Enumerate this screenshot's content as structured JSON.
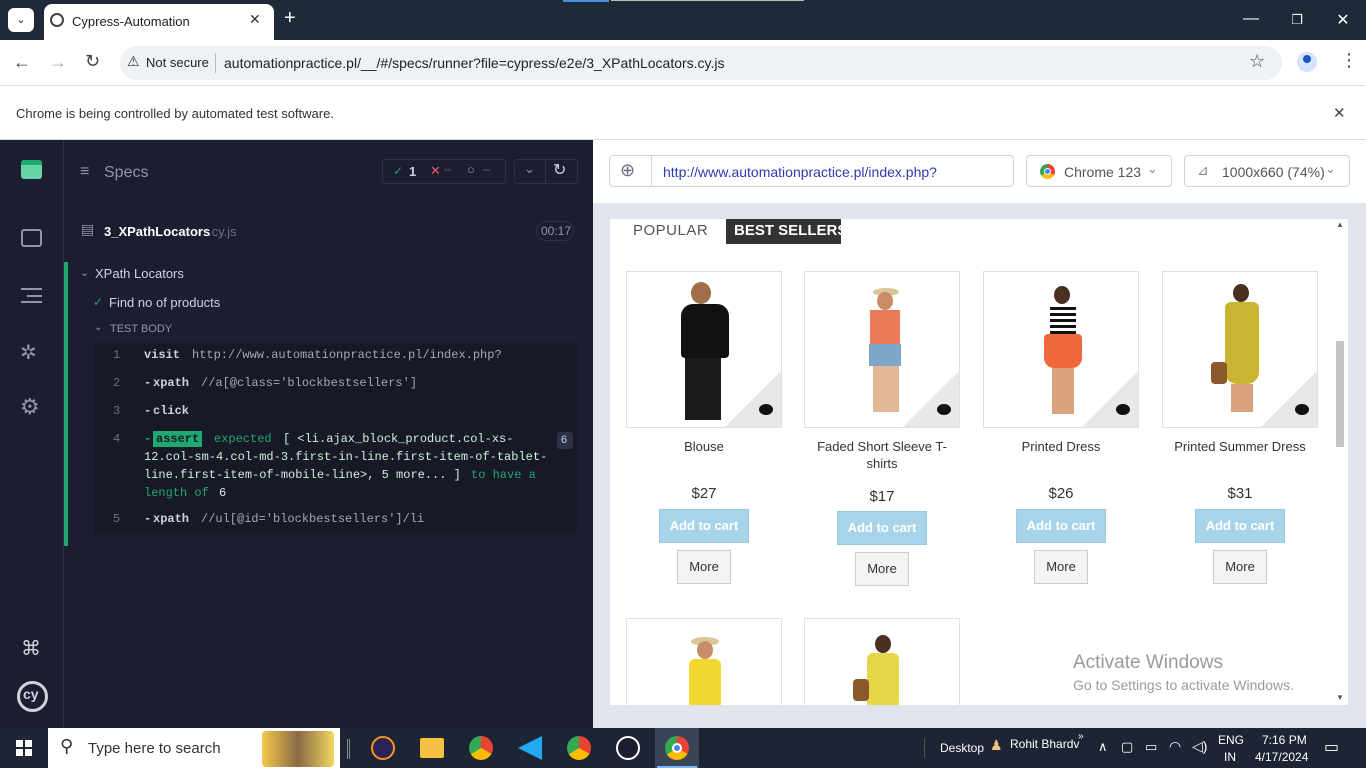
{
  "browser": {
    "tab_title": "Cypress-Automation",
    "not_secure": "Not secure",
    "url": "automationpractice.pl/__/#/specs/runner?file=cypress/e2e/3_XPathLocators.cy.js",
    "infobar": "Chrome is being controlled by automated test software."
  },
  "reporter": {
    "specs_label": "Specs",
    "passed_count": "1",
    "failed_count": "--",
    "pending_count": "--",
    "spec_name": "3_XPathLocators",
    "spec_ext": ".cy.js",
    "duration": "00:17",
    "suite_name": "XPath Locators",
    "test_name": "Find no of products",
    "test_body_label": "TEST BODY",
    "commands": [
      {
        "num": "1",
        "prefix": "",
        "name": "visit",
        "msg": "http://www.automationpractice.pl/index.php?"
      },
      {
        "num": "2",
        "prefix": "-",
        "name": "xpath",
        "msg": "//a[@class='blockbestsellers']"
      },
      {
        "num": "3",
        "prefix": "-",
        "name": "click",
        "msg": ""
      },
      {
        "num": "4",
        "prefix": "-",
        "name": "assert",
        "msg_a": "expected",
        "msg_b": "[ <li.ajax_block_product.col-xs-",
        "msg_c": "12.col-sm-4.col-md-3.first-in-line.first-item-of-tablet-",
        "msg_d": "line.first-item-of-mobile-line>, 5 more... ]",
        "msg_e": "to have a",
        "msg_f": "length of",
        "msg_g": "6",
        "badge": "6"
      },
      {
        "num": "5",
        "prefix": "-",
        "name": "xpath",
        "msg": "//ul[@id='blockbestsellers']/li"
      }
    ]
  },
  "aut": {
    "url": "http://www.automationpractice.pl/index.php?",
    "browser_name": "Chrome 123",
    "viewport": "1000x660 (74%)",
    "tab_popular": "POPULAR",
    "tab_bestsellers": "BEST SELLERS",
    "products": [
      {
        "name": "Blouse",
        "price": "$27",
        "cart": "Add to cart",
        "more": "More"
      },
      {
        "name": "Faded Short Sleeve T-shirts",
        "price": "$17",
        "cart": "Add to cart",
        "more": "More"
      },
      {
        "name": "Printed Dress",
        "price": "$26",
        "cart": "Add to cart",
        "more": "More"
      },
      {
        "name": "Printed Summer Dress",
        "price": "$31",
        "cart": "Add to cart",
        "more": "More"
      }
    ],
    "watermark_title": "Activate Windows",
    "watermark_sub": "Go to Settings to activate Windows."
  },
  "taskbar": {
    "search_placeholder": "Type here to search",
    "desktop": "Desktop",
    "user": "Rohit Bhardv",
    "lang_a": "ENG",
    "lang_b": "IN",
    "time": "7:16 PM",
    "date": "4/17/2024"
  },
  "colors": {
    "cypress_bg": "#1b1e2e",
    "pass_green": "#1fa971",
    "accent_blue": "#2e3bb0"
  }
}
